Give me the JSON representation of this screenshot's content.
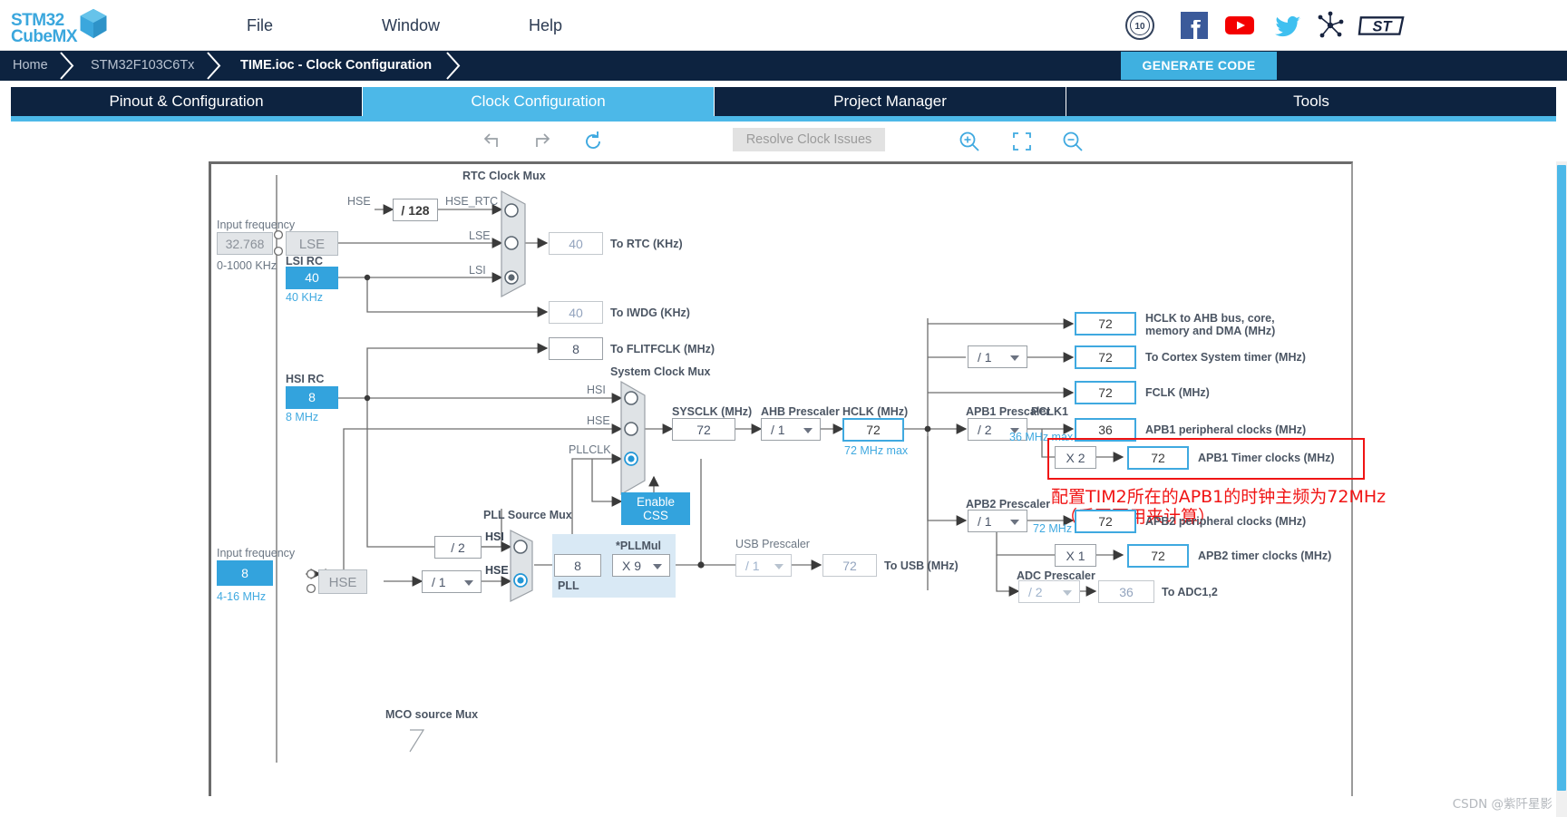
{
  "app": {
    "logo_line1": "STM32",
    "logo_line2": "CubeMX",
    "cube_icon": "cube-icon"
  },
  "menubar": {
    "items": [
      {
        "label": "File",
        "name": "menu-file"
      },
      {
        "label": "Window",
        "name": "menu-window"
      },
      {
        "label": "Help",
        "name": "menu-help"
      }
    ],
    "social_icons": [
      {
        "name": "anniversary-10-icon",
        "title": "10"
      },
      {
        "name": "facebook-icon",
        "title": "f"
      },
      {
        "name": "youtube-icon",
        "title": "youtube"
      },
      {
        "name": "twitter-icon",
        "title": "twitter"
      },
      {
        "name": "share-network-icon",
        "title": "share"
      },
      {
        "name": "st-logo-icon",
        "title": "ST"
      }
    ]
  },
  "breadcrumb": {
    "home": "Home",
    "mcu": "STM32F103C6Tx",
    "file": "TIME.ioc - Clock Configuration",
    "generate_code": "GENERATE CODE"
  },
  "tabs": [
    {
      "label": "Pinout & Configuration",
      "selected": false
    },
    {
      "label": "Clock Configuration",
      "selected": true
    },
    {
      "label": "Project Manager",
      "selected": false
    },
    {
      "label": "Tools",
      "selected": false
    }
  ],
  "toolbar": {
    "undo_icon": "undo-icon",
    "redo_icon": "redo-icon",
    "reset_icon": "reset-icon",
    "resolve_clock_issues": "Resolve Clock Issues",
    "zoom_in_icon": "zoom-in-icon",
    "fit_icon": "fit-to-screen-icon",
    "zoom_out_icon": "zoom-out-icon"
  },
  "colors": {
    "accent": "#4cb8e8",
    "navy": "#0d2340",
    "cyan_fill": "#33a3dd",
    "annotation_red": "#f01414",
    "blue_border": "#3fa9e0"
  },
  "diagram": {
    "lse": {
      "input_frequency_label": "Input frequency",
      "input_frequency_value": "32.768",
      "range": "0-1000 KHz",
      "osc_label": "LSE"
    },
    "lsi": {
      "title": "LSI RC",
      "value": "40",
      "unit": "40 KHz"
    },
    "hse_div128": {
      "in_label": "HSE",
      "value": "/ 128",
      "out_label": "HSE_RTC"
    },
    "rtc_mux": {
      "title": "RTC Clock Mux",
      "inputs": [
        "HSE_RTC",
        "LSE",
        "LSI"
      ],
      "selected_index": 2
    },
    "to_rtc": {
      "value": "40",
      "label": "To RTC (KHz)"
    },
    "to_iwdg": {
      "value": "40",
      "label": "To IWDG (KHz)"
    },
    "to_flitfclk": {
      "value": "8",
      "label": "To FLITFCLK (MHz)"
    },
    "hsi": {
      "title": "HSI RC",
      "value": "8",
      "unit": "8 MHz"
    },
    "hse": {
      "input_frequency_label": "Input frequency",
      "input_frequency_value": "8",
      "range": "4-16 MHz",
      "osc_label": "HSE",
      "prescaler": "/ 1"
    },
    "sysclk_mux": {
      "title": "System Clock Mux",
      "inputs": [
        "HSI",
        "HSE",
        "PLLCLK"
      ],
      "selected_index": 2
    },
    "enable_css": "Enable CSS",
    "sysclk": {
      "label": "SYSCLK (MHz)",
      "value": "72"
    },
    "ahb_prescaler": {
      "label": "AHB Prescaler",
      "value": "/ 1"
    },
    "hclk": {
      "label": "HCLK (MHz)",
      "value": "72",
      "max": "72 MHz max"
    },
    "pll_source_mux": {
      "title": "PLL Source Mux",
      "inputs": [
        "HSI",
        "HSE"
      ],
      "selected_index": 1,
      "hsi_div": "/ 2"
    },
    "pll": {
      "panel_label": "PLL",
      "input_value": "8",
      "mul_label": "*PLLMul",
      "mul_value": "X 9"
    },
    "usb_prescaler": {
      "label": "USB Prescaler",
      "value": "/ 1"
    },
    "to_usb": {
      "value": "72",
      "label": "To USB (MHz)"
    },
    "outputs": [
      {
        "value": "72",
        "label": "HCLK to AHB bus, core,",
        "label2": "memory and DMA (MHz)",
        "blue": true
      },
      {
        "value": "72",
        "label": "To Cortex System timer (MHz)",
        "blue": true
      },
      {
        "value": "72",
        "label": "FCLK (MHz)",
        "blue": true
      }
    ],
    "cortex_prescaler": "/ 1",
    "apb1": {
      "prescaler_label": "APB1 Prescaler",
      "prescaler_value": "/ 2",
      "pclk_label": "PCLK1",
      "max": "36 MHz max",
      "periph_value": "36",
      "periph_label": "APB1 peripheral clocks (MHz)",
      "timer_mul": "X 2",
      "timer_value": "72",
      "timer_label": "APB1 Timer clocks (MHz)"
    },
    "apb2": {
      "prescaler_label": "APB2 Prescaler",
      "prescaler_value": "/ 1",
      "max": "72 MHz max",
      "periph_value": "72",
      "periph_label": "APB2 peripheral clocks (MHz)",
      "timer_mul": "X 1",
      "timer_value": "72",
      "timer_label": "APB2 timer clocks (MHz)"
    },
    "adc": {
      "prescaler_label": "ADC Prescaler",
      "prescaler_value": "/ 2",
      "value": "36",
      "label": "To ADC1,2"
    },
    "mco": {
      "title": "MCO source Mux"
    },
    "annotation": {
      "line1": "配置TIM2所在的APB1的时钟主频为72MHz",
      "line2": "（后图要用来计算）"
    }
  },
  "watermark": "CSDN @紫阡星影"
}
